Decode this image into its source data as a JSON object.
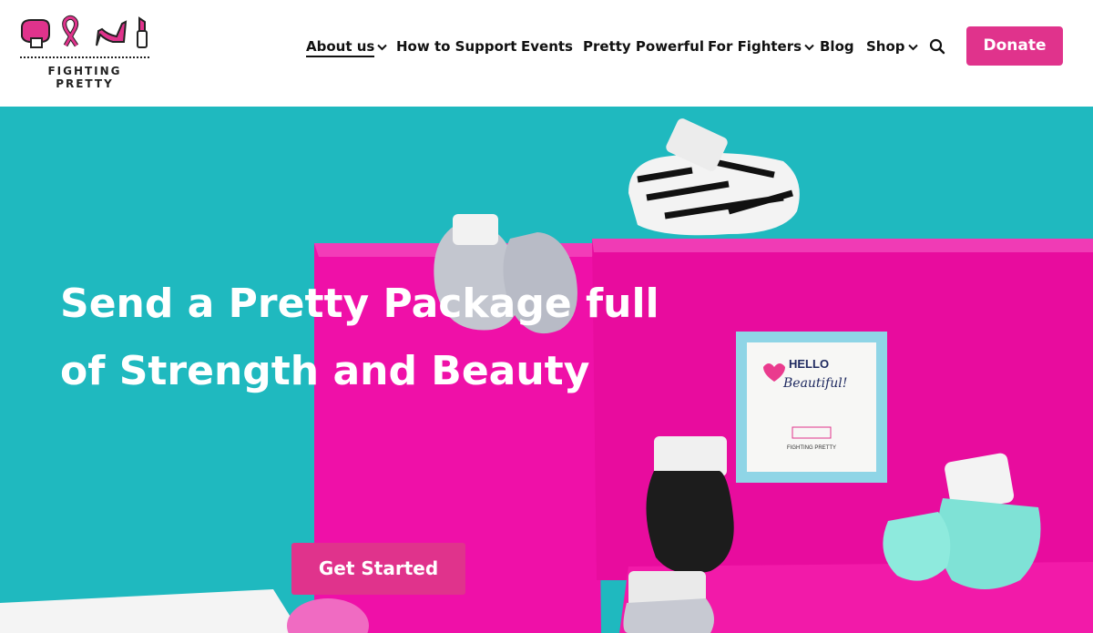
{
  "brand": {
    "name": "FIGHTING PRETTY",
    "accent": "#e0338c",
    "icons": [
      "boxing-glove-icon",
      "ribbon-icon",
      "high-heel-icon",
      "lipstick-icon"
    ]
  },
  "nav": {
    "items": [
      {
        "label": "About us",
        "has_dropdown": true,
        "active": true
      },
      {
        "label": "How to Support",
        "has_dropdown": false
      },
      {
        "label": "Events",
        "has_dropdown": false
      },
      {
        "label": "Pretty Powerful",
        "has_dropdown": false
      },
      {
        "label": "For Fighters",
        "has_dropdown": true
      },
      {
        "label": "Blog",
        "has_dropdown": false
      },
      {
        "label": "Shop",
        "has_dropdown": true
      }
    ],
    "search_icon": "search-icon",
    "donate_label": "Donate"
  },
  "hero": {
    "headline": "Send a Pretty Package full of Strength and Beauty",
    "cta_label": "Get Started",
    "background_color": "#1fb9bf",
    "card": {
      "line1": "HELLO",
      "line2": "Beautiful!",
      "brand": "FIGHTING PRETTY"
    }
  }
}
